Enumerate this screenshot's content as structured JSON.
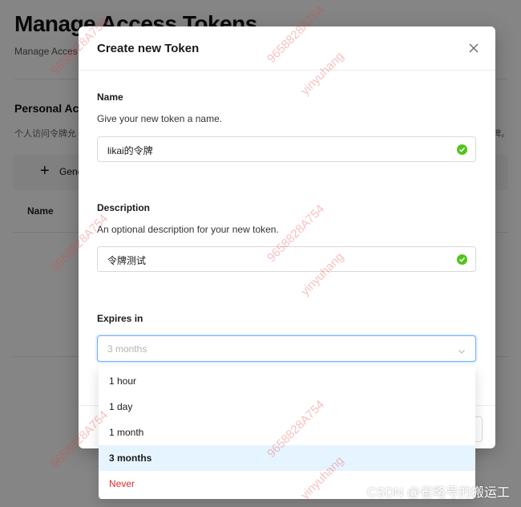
{
  "background": {
    "title": "Manage Access Tokens",
    "subtitle": "Manage Acces",
    "section_title": "Personal Acc",
    "section_desc": "个人访问令牌允",
    "section_desc_tail": "牌。",
    "generate_label": "Gene",
    "column_name": "Name"
  },
  "modal": {
    "title": "Create new Token",
    "name": {
      "label": "Name",
      "help": "Give your new token a name.",
      "value": "likai的令牌"
    },
    "description": {
      "label": "Description",
      "help": "An optional description for your new token.",
      "value": "令牌测试"
    },
    "expires": {
      "label": "Expires in",
      "placeholder": "3 months",
      "options": [
        "1 hour",
        "1 day",
        "1 month",
        "3 months",
        "Never"
      ],
      "selected": "3 months"
    }
  },
  "watermark": {
    "text_a": "9658828A754",
    "text_b": "yinyuhang",
    "footer": "CSDN @省略号的搬运工"
  },
  "colors": {
    "accent": "#1677ff",
    "success": "#52c41a",
    "danger": "#e0282e",
    "selected_bg": "#e6f4ff"
  }
}
